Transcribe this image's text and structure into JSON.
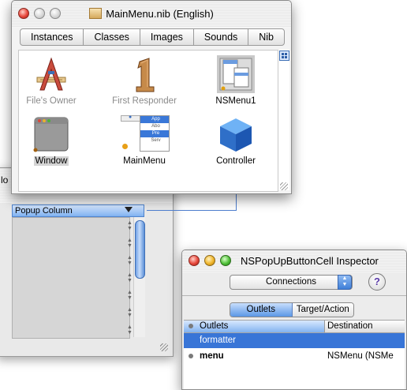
{
  "nib_window": {
    "title": "MainMenu.nib (English)",
    "tabs": [
      "Instances",
      "Classes",
      "Images",
      "Sounds",
      "Nib"
    ],
    "instances": [
      {
        "label": "File's Owner",
        "icon": "files-owner-icon"
      },
      {
        "label": "First Responder",
        "icon": "first-responder-icon"
      },
      {
        "label": "NSMenu1",
        "icon": "nsmenu-icon"
      },
      {
        "label": "Window",
        "icon": "window-icon"
      },
      {
        "label": "MainMenu",
        "icon": "main-menu-icon"
      },
      {
        "label": "Controller",
        "icon": "controller-cube-icon"
      }
    ],
    "menu_preview_items": [
      "App",
      "Abo",
      "Pre",
      "Serv"
    ]
  },
  "background_window": {
    "title_fragment": "lo",
    "column_header": "Popup Column"
  },
  "inspector": {
    "title": "NSPopUpButtonCell Inspector",
    "mode_popup": "Connections",
    "help_label": "?",
    "segments": [
      "Outlets",
      "Target/Action"
    ],
    "columns": {
      "outlets": "Outlets",
      "destination": "Destination"
    },
    "rows": [
      {
        "name": "formatter",
        "destination": ""
      },
      {
        "name": "menu",
        "destination": "NSMenu (NSMe"
      }
    ]
  },
  "colors": {
    "selection_blue": "#3875d7",
    "connection_line": "#4f7fd0"
  }
}
